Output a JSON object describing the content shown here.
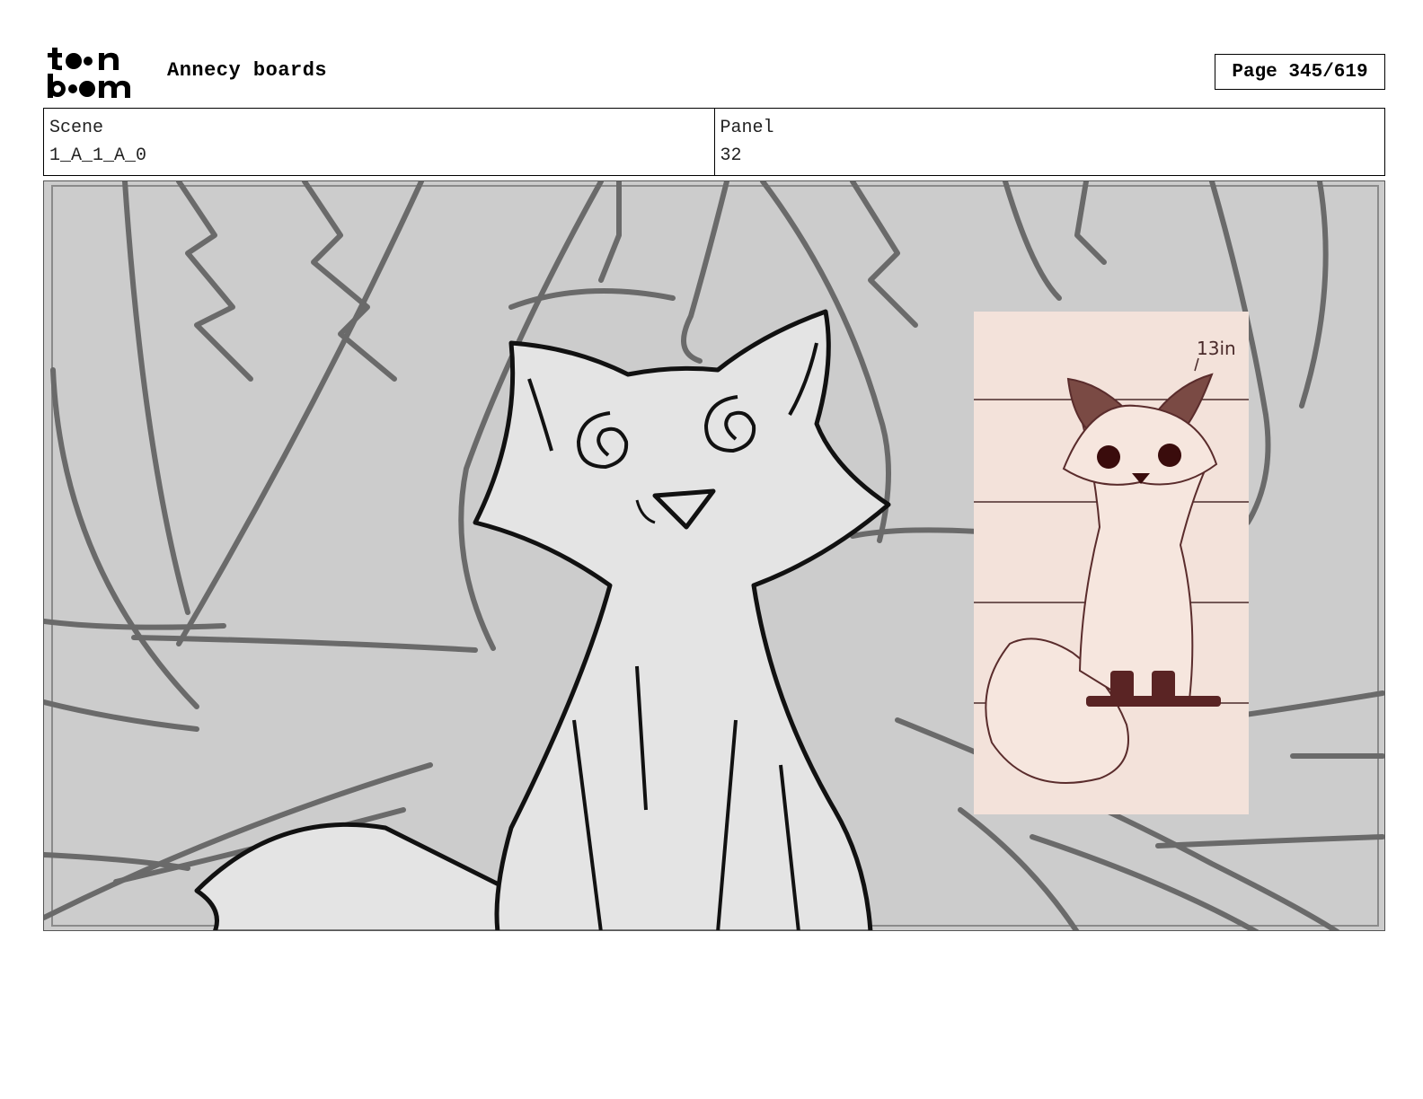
{
  "header": {
    "logo_text": "toon boom",
    "title": "Annecy boards",
    "page_label": "Page 345/619"
  },
  "info": {
    "scene_label": "Scene",
    "scene_value": "1_A_1_A_0",
    "panel_label": "Panel",
    "panel_value": "32"
  },
  "panel_image": {
    "description_icon": "storyboard-sketch-fox-in-forest",
    "reference_note": "13in"
  },
  "colors": {
    "panel_bg": "#cfcfcf",
    "sketch_line": "#6a6a6a",
    "fox_fill": "#e6e6e6",
    "reference_bg": "#f3e2da",
    "reference_ink": "#4a2020"
  }
}
